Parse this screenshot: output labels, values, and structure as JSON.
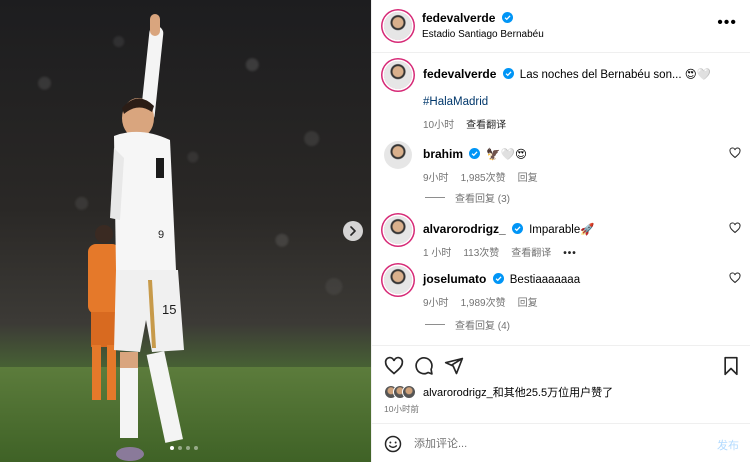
{
  "header": {
    "username": "fedevalverde",
    "location": "Estadio Santiago Bernabéu"
  },
  "caption": {
    "username": "fedevalverde",
    "text": "Las noches del Bernabéu son... 😍🤍",
    "hashtag": "#HalaMadrid",
    "time": "10小时",
    "translate": "查看翻译"
  },
  "comments": [
    {
      "username": "brahim",
      "text": "🦅🤍😍",
      "time": "9小时",
      "likes": "1,985次赞",
      "reply": "回复",
      "view_replies": "查看回复 (3)"
    },
    {
      "username": "alvarorodrigz_",
      "text": "Imparable🚀",
      "time": "1 小时",
      "likes": "113次赞",
      "translate": "查看翻译",
      "more": "•••"
    },
    {
      "username": "joselumato",
      "text": "Bestiaaaaaaa",
      "time": "9小时",
      "likes": "1,989次赞",
      "reply": "回复",
      "view_replies": "查看回复 (4)"
    }
  ],
  "likes_summary": "alvarorodrigz_和其他25.5万位用户赞了",
  "post_time": "10小时前",
  "comment_input": {
    "placeholder": "添加评论...",
    "post_label": "发布"
  },
  "photo": {
    "jersey_number": "15"
  },
  "colors": {
    "verified": "#0095f6",
    "link": "#00376b",
    "muted": "#737373",
    "post_disabled": "#b3dbff"
  },
  "icons": [
    "more-icon",
    "heart-icon",
    "comment-icon",
    "share-icon",
    "bookmark-icon",
    "emoji-icon",
    "chevron-right-icon",
    "verified-icon"
  ]
}
